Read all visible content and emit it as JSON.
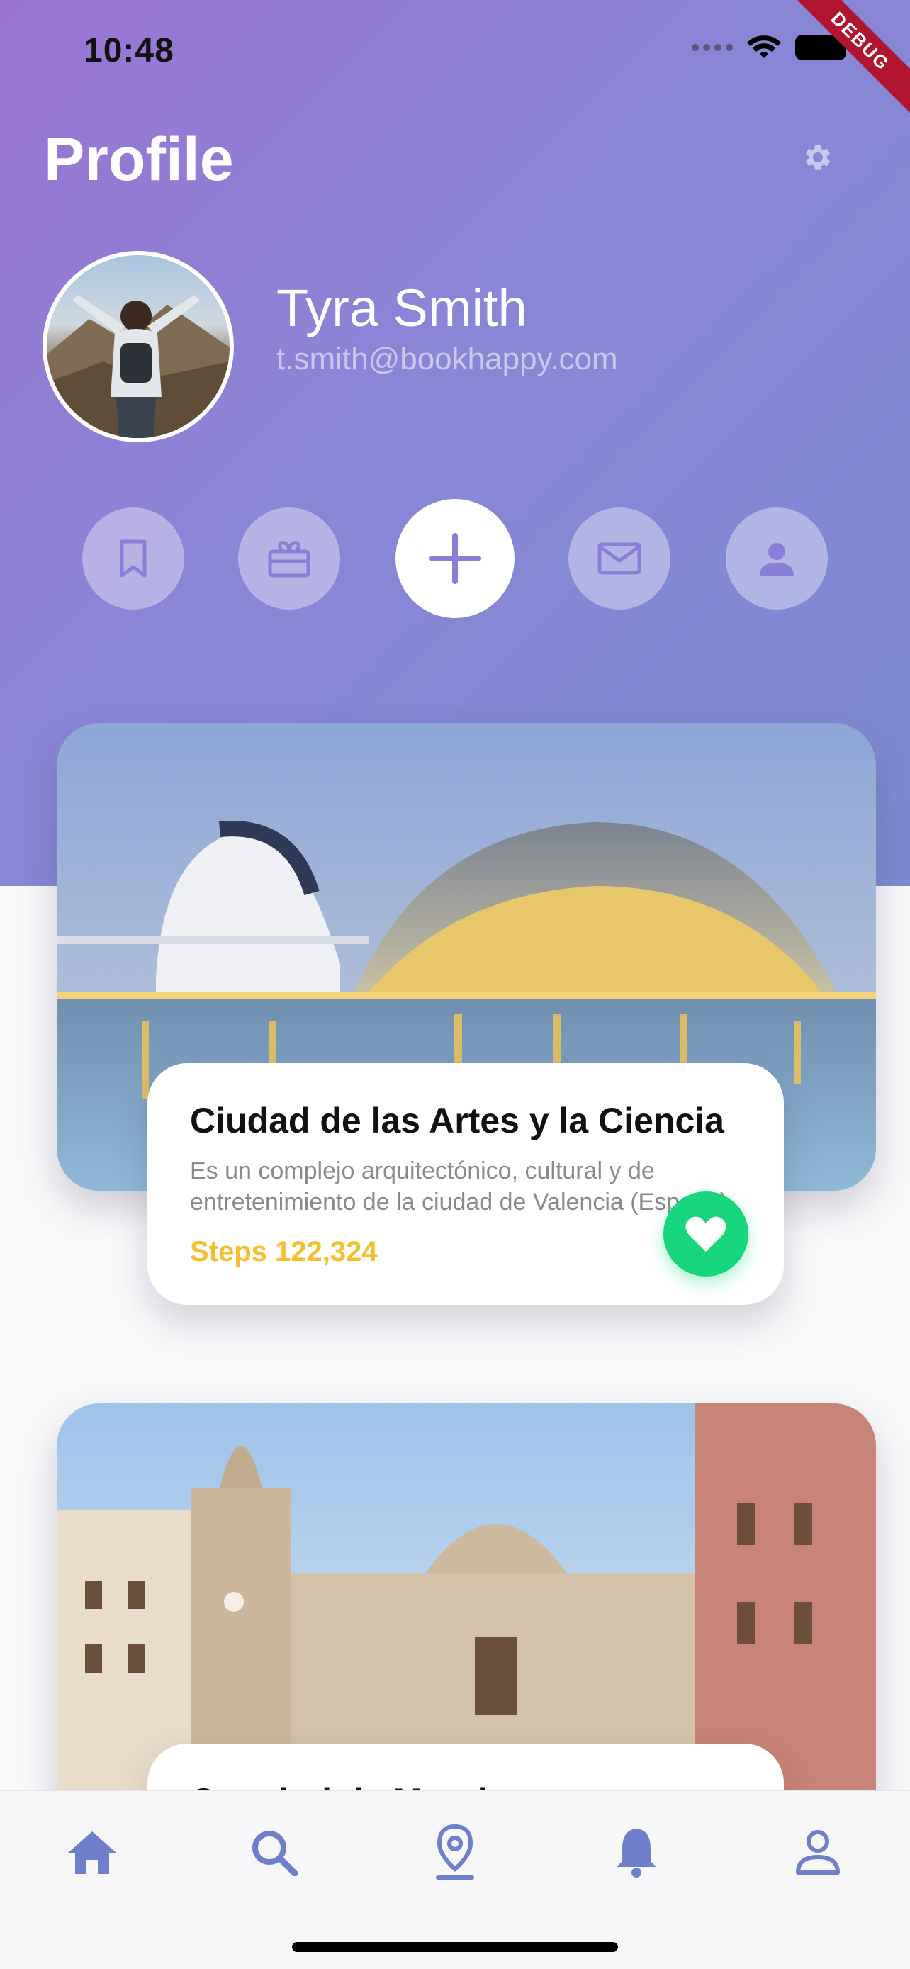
{
  "status_bar": {
    "time": "10:48"
  },
  "debug_badge": "DEBUG",
  "header": {
    "title": "Profile"
  },
  "user": {
    "name": "Tyra Smith",
    "email": "t.smith@bookhappy.com"
  },
  "actions": [
    {
      "icon": "bookmark-icon"
    },
    {
      "icon": "gift-icon"
    },
    {
      "icon": "plus-icon"
    },
    {
      "icon": "mail-icon"
    },
    {
      "icon": "person-icon"
    }
  ],
  "cards": [
    {
      "title": "Ciudad de las Artes y la Ciencia",
      "description": "Es un complejo arquitectónico, cultural y de entretenimiento de la ciudad de Valencia (España).",
      "steps": "Steps 122,324"
    },
    {
      "title": "Catedral de Murcia"
    }
  ],
  "bottom_nav": [
    {
      "icon": "home-icon",
      "active": true
    },
    {
      "icon": "search-icon"
    },
    {
      "icon": "location-pin-icon"
    },
    {
      "icon": "bell-icon"
    },
    {
      "icon": "profile-icon"
    }
  ],
  "colors": {
    "accent": "#8a7fd6",
    "steps": "#f4bf32",
    "favorite": "#18d67d",
    "nav": "#6f7fcc"
  }
}
